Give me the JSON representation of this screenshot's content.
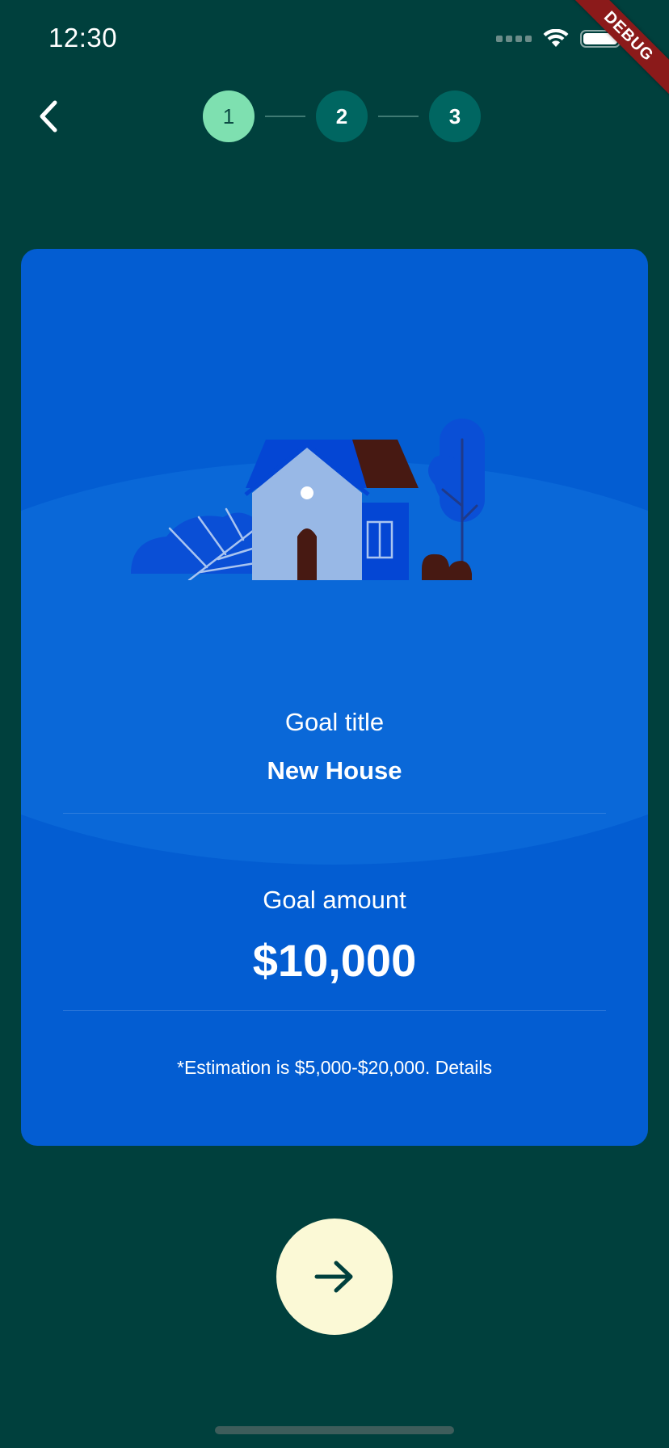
{
  "status_bar": {
    "time": "12:30"
  },
  "debug_banner": "DEBUG",
  "header": {
    "steps": [
      {
        "label": "1",
        "state": "active"
      },
      {
        "label": "2",
        "state": "inactive"
      },
      {
        "label": "3",
        "state": "inactive"
      }
    ]
  },
  "card": {
    "illustration_icon": "house-illustration",
    "goal_title_label": "Goal title",
    "goal_title_value": "New House",
    "goal_amount_label": "Goal amount",
    "goal_amount_value": "$10,000",
    "estimation_note": "*Estimation is $5,000-$20,000. Details"
  },
  "actions": {
    "next_icon": "arrow-right-icon",
    "back_icon": "chevron-left-icon"
  },
  "colors": {
    "background": "#00403d",
    "card": "#035dd2",
    "step_active": "#7ee0b0",
    "step_inactive": "#006661",
    "next_button": "#fbf9d6"
  }
}
